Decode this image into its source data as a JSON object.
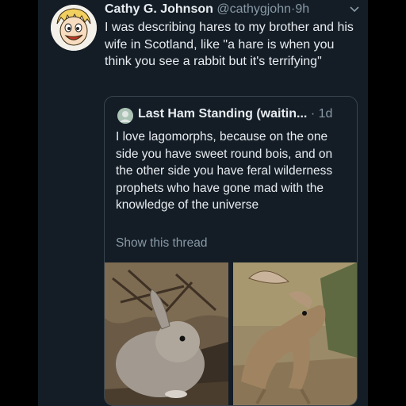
{
  "tweet": {
    "author_name": "Cathy G. Johnson",
    "author_handle": "@cathygjohn",
    "separator": "·",
    "time": "9h",
    "text": "I was describing hares to my brother and his wife in Scotland, like \"a hare is when you think you see a rabbit but it's terrifying\""
  },
  "quoted_tweet": {
    "author_name": "Last Ham Standing (waitin...",
    "meta": "· 1d",
    "text": "I love lagomorphs, because on the one side you have sweet round bois, and on the other side you have feral wilderness prophets who have gone mad with the knowledge of the universe",
    "show_thread_label": "Show this thread"
  },
  "icons": {
    "avatar": "cartoon-avatar-icon",
    "more": "chevron-down-icon",
    "quoted_avatar": "avatar-icon"
  },
  "colors": {
    "background": "#141d26",
    "text": "#e8ecf0",
    "secondary_text": "#8899a6",
    "border": "#38444d"
  }
}
